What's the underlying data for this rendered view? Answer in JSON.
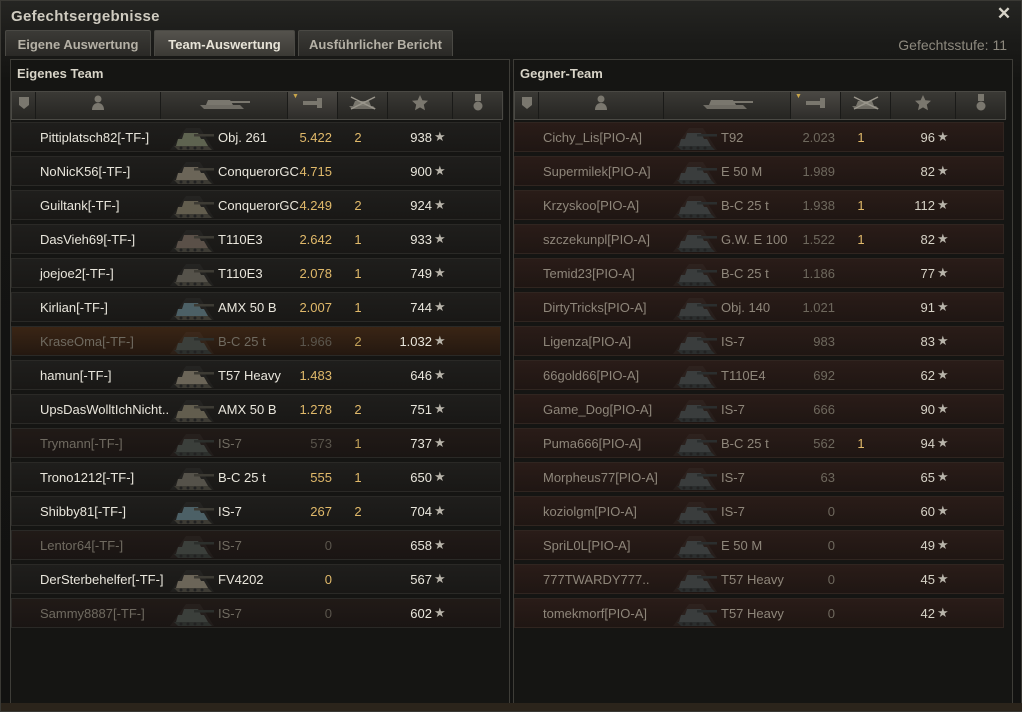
{
  "window": {
    "title": "Gefechtsergebnisse",
    "close_icon": "close-icon",
    "level_text": "Gefechtsstufe: 11"
  },
  "tabs": [
    {
      "label": "Eigene Auswertung",
      "active": false
    },
    {
      "label": "Team-Auswertung",
      "active": true
    },
    {
      "label": "Ausführlicher Bericht",
      "active": false
    }
  ],
  "columns": {
    "icons": [
      "squad-icon",
      "player-icon",
      "tank-icon",
      "damage-icon",
      "kills-icon",
      "xp-star-icon",
      "medal-icon"
    ],
    "sorted_column": "damage-icon"
  },
  "own_team": {
    "title": "Eigenes Team",
    "rows": [
      {
        "name": "Pittiplatsch82[-TF-]",
        "tank": "Obj. 261",
        "damage": "5.422",
        "kills": "2",
        "xp": "938",
        "dead": false,
        "highlight": false
      },
      {
        "name": "NoNicK56[-TF-]",
        "tank": "ConquerorGC",
        "damage": "4.715",
        "kills": "",
        "xp": "900",
        "dead": false,
        "highlight": false
      },
      {
        "name": "Guiltank[-TF-]",
        "tank": "ConquerorGC",
        "damage": "4.249",
        "kills": "2",
        "xp": "924",
        "dead": false,
        "highlight": false
      },
      {
        "name": "DasVieh69[-TF-]",
        "tank": "T110E3",
        "damage": "2.642",
        "kills": "1",
        "xp": "933",
        "dead": false,
        "highlight": false
      },
      {
        "name": "joejoe2[-TF-]",
        "tank": "T110E3",
        "damage": "2.078",
        "kills": "1",
        "xp": "749",
        "dead": false,
        "highlight": false
      },
      {
        "name": "Kirlian[-TF-]",
        "tank": "AMX 50 B",
        "damage": "2.007",
        "kills": "1",
        "xp": "744",
        "dead": false,
        "highlight": false
      },
      {
        "name": "KraseOma[-TF-]",
        "tank": "B-C 25 t",
        "damage": "1.966",
        "kills": "2",
        "xp": "1.032",
        "dead": true,
        "highlight": true
      },
      {
        "name": "hamun[-TF-]",
        "tank": "T57 Heavy",
        "damage": "1.483",
        "kills": "",
        "xp": "646",
        "dead": false,
        "highlight": false
      },
      {
        "name": "UpsDasWolltIchNicht..",
        "tank": "AMX 50 B",
        "damage": "1.278",
        "kills": "2",
        "xp": "751",
        "dead": false,
        "highlight": false
      },
      {
        "name": "Trymann[-TF-]",
        "tank": "IS-7",
        "damage": "573",
        "kills": "1",
        "xp": "737",
        "dead": true,
        "highlight": false
      },
      {
        "name": "Trono1212[-TF-]",
        "tank": "B-C 25 t",
        "damage": "555",
        "kills": "1",
        "xp": "650",
        "dead": false,
        "highlight": false
      },
      {
        "name": "Shibby81[-TF-]",
        "tank": "IS-7",
        "damage": "267",
        "kills": "2",
        "xp": "704",
        "dead": false,
        "highlight": false
      },
      {
        "name": "Lentor64[-TF-]",
        "tank": "IS-7",
        "damage": "0",
        "kills": "",
        "xp": "658",
        "dead": true,
        "highlight": false
      },
      {
        "name": "DerSterbehelfer[-TF-]",
        "tank": "FV4202",
        "damage": "0",
        "kills": "",
        "xp": "567",
        "dead": false,
        "highlight": false
      },
      {
        "name": "Sammy8887[-TF-]",
        "tank": "IS-7",
        "damage": "0",
        "kills": "",
        "xp": "602",
        "dead": true,
        "highlight": false
      }
    ]
  },
  "enemy_team": {
    "title": "Gegner-Team",
    "rows": [
      {
        "name": "Cichy_Lis[PIO-A]",
        "tank": "T92",
        "damage": "2.023",
        "kills": "1",
        "xp": "96"
      },
      {
        "name": "Supermilek[PIO-A]",
        "tank": "E 50 M",
        "damage": "1.989",
        "kills": "",
        "xp": "82"
      },
      {
        "name": "Krzyskoo[PIO-A]",
        "tank": "B-C 25 t",
        "damage": "1.938",
        "kills": "1",
        "xp": "112"
      },
      {
        "name": "szczekunpl[PIO-A]",
        "tank": "G.W. E 100",
        "damage": "1.522",
        "kills": "1",
        "xp": "82"
      },
      {
        "name": "Temid23[PIO-A]",
        "tank": "B-C 25 t",
        "damage": "1.186",
        "kills": "",
        "xp": "77"
      },
      {
        "name": "DirtyTricks[PIO-A]",
        "tank": "Obj. 140",
        "damage": "1.021",
        "kills": "",
        "xp": "91"
      },
      {
        "name": "Ligenza[PIO-A]",
        "tank": "IS-7",
        "damage": "983",
        "kills": "",
        "xp": "83"
      },
      {
        "name": "66gold66[PIO-A]",
        "tank": "T110E4",
        "damage": "692",
        "kills": "",
        "xp": "62"
      },
      {
        "name": "Game_Dog[PIO-A]",
        "tank": "IS-7",
        "damage": "666",
        "kills": "",
        "xp": "90"
      },
      {
        "name": "Puma666[PIO-A]",
        "tank": "B-C 25 t",
        "damage": "562",
        "kills": "1",
        "xp": "94"
      },
      {
        "name": "Morpheus77[PIO-A]",
        "tank": "IS-7",
        "damage": "63",
        "kills": "",
        "xp": "65"
      },
      {
        "name": "koziolgm[PIO-A]",
        "tank": "IS-7",
        "damage": "0",
        "kills": "",
        "xp": "60"
      },
      {
        "name": "SpriL0L[PIO-A]",
        "tank": "E 50 M",
        "damage": "0",
        "kills": "",
        "xp": "49"
      },
      {
        "name": "777TWARDY777..",
        "tank": "T57 Heavy",
        "damage": "0",
        "kills": "",
        "xp": "45"
      },
      {
        "name": "tomekmorf[PIO-A]",
        "tank": "T57 Heavy",
        "damage": "0",
        "kills": "",
        "xp": "42"
      }
    ]
  }
}
